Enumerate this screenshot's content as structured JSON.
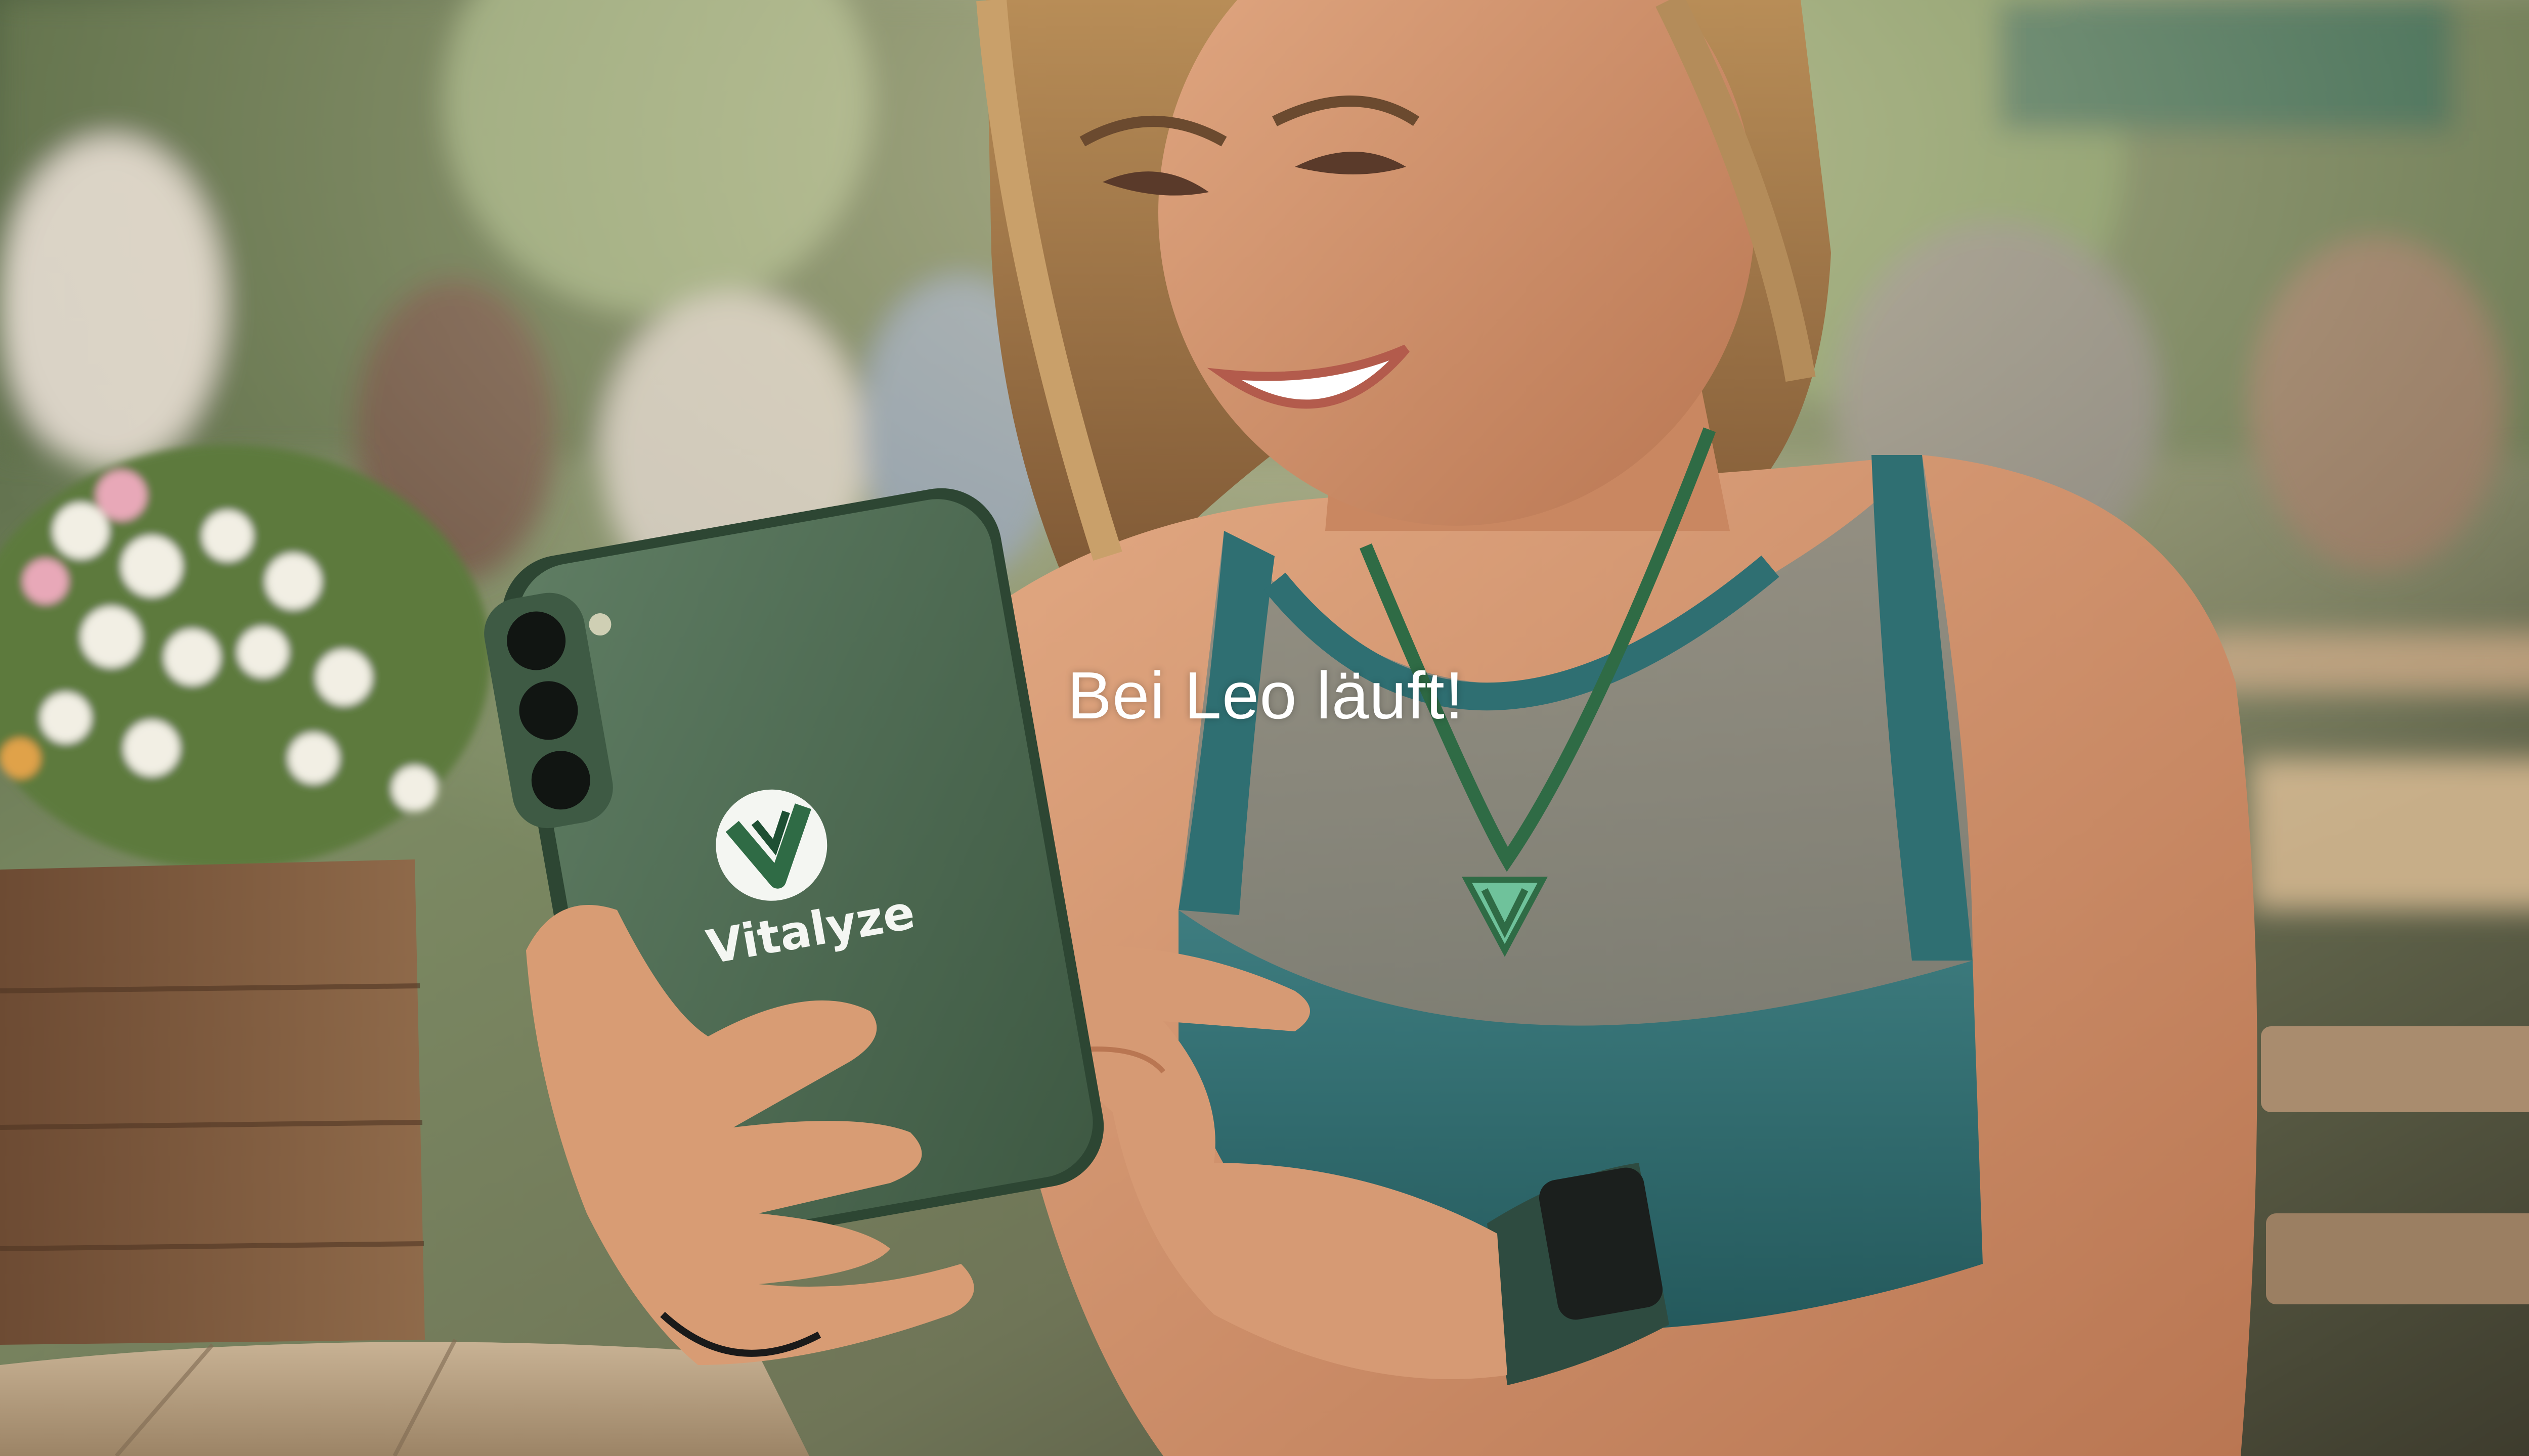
{
  "caption": {
    "text": "Bei Leo läuft!"
  },
  "phone_brand": {
    "name": "Vitalyze",
    "logo_letter": "V"
  },
  "colors": {
    "brand_green": "#2f6b45",
    "phone_case": "#4e6b52",
    "top_teal": "#2f6f72",
    "caption_text": "#ffffff"
  },
  "scene": {
    "description_icons": [
      "woman-figure",
      "smartphone",
      "pendant-icon",
      "smartwatch",
      "cafe-background"
    ]
  }
}
